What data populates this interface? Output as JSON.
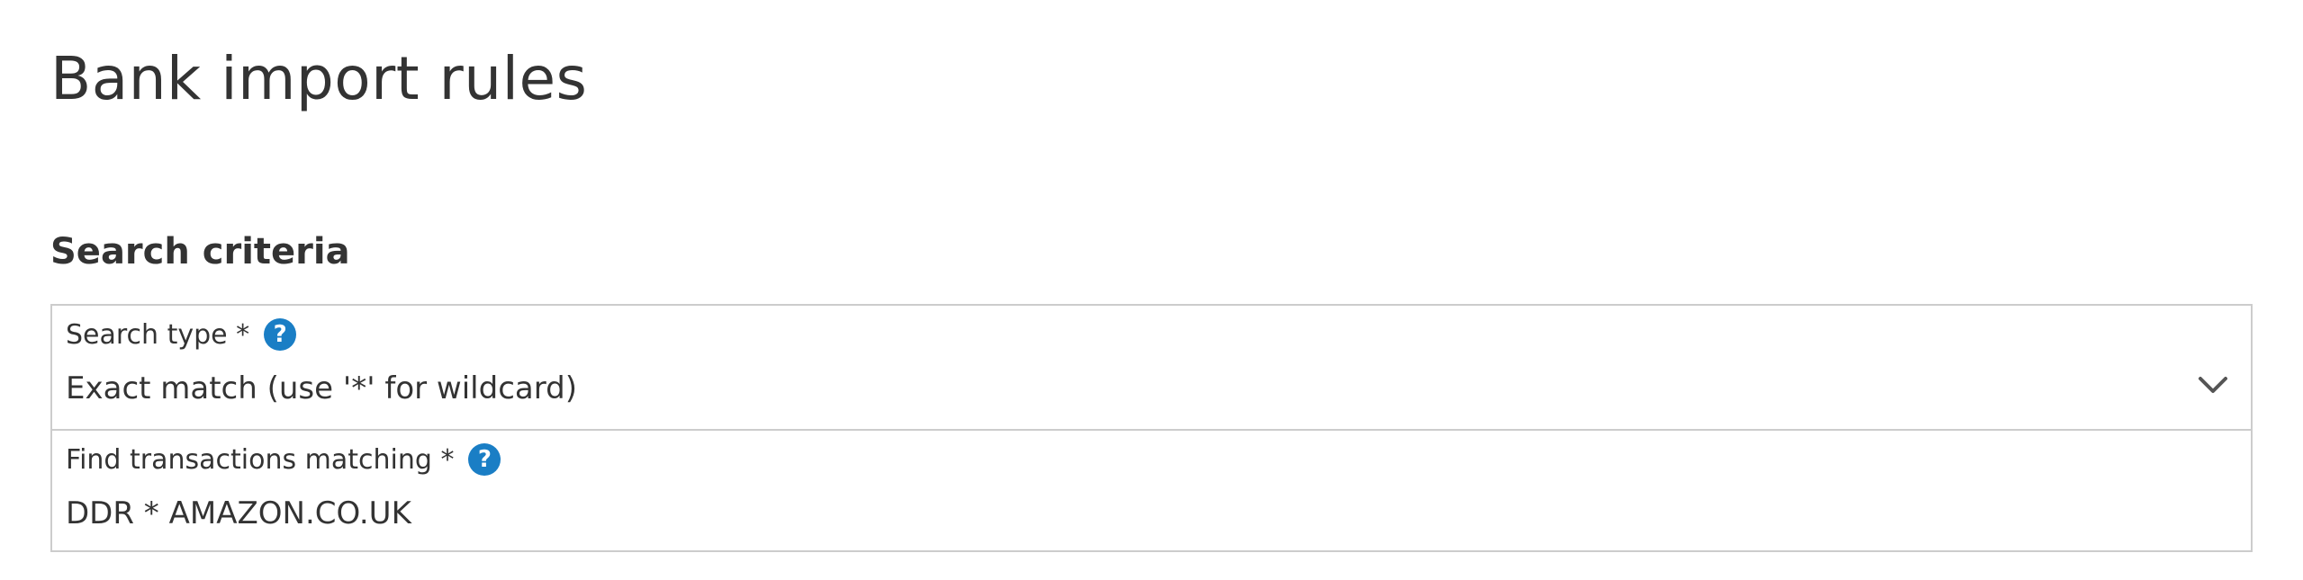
{
  "page": {
    "title": "Bank import rules"
  },
  "search_criteria": {
    "heading": "Search criteria",
    "search_type": {
      "label": "Search type *",
      "value": "Exact match (use '*' for wildcard)",
      "help_icon": "question-circle-icon",
      "dropdown_icon": "chevron-down-icon"
    },
    "find_transactions": {
      "label": "Find transactions matching *",
      "value": "DDR * AMAZON.CO.UK",
      "help_icon": "question-circle-icon"
    }
  },
  "colors": {
    "help_icon": "#1a7ec5",
    "border": "#cccccc",
    "text": "#333333"
  }
}
